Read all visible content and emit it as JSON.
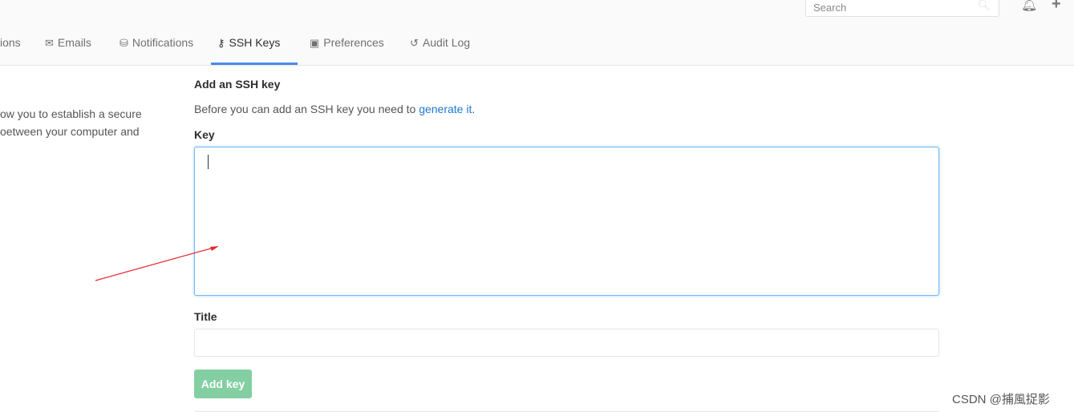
{
  "header": {
    "search_placeholder": "Search",
    "icons": [
      "search-icon",
      "bell-icon",
      "plus-icon"
    ]
  },
  "tabs": [
    {
      "label": "ions",
      "icon": ""
    },
    {
      "label": "Emails",
      "icon": "✉"
    },
    {
      "label": "Notifications",
      "icon": "⛁"
    },
    {
      "label": "SSH Keys",
      "icon": "🔑",
      "active": true
    },
    {
      "label": "Preferences",
      "icon": "▣"
    },
    {
      "label": "Audit Log",
      "icon": "↺"
    }
  ],
  "sidebar": {
    "line1": "ow you to establish a secure",
    "line2": "oetween your computer and"
  },
  "form": {
    "heading": "Add an SSH key",
    "desc": "Before you can add an SSH key you need to ",
    "desc_link": "generate it",
    "desc_end": ".",
    "key_label": "Key",
    "key_value": "",
    "title_label": "Title",
    "title_value": "",
    "submit": "Add key"
  },
  "watermark": "CSDN @捕風捉影",
  "colors": {
    "accent": "#4a8bee",
    "link": "#1f78d1",
    "button": "#83cfa2",
    "annotation_arrow": "#e8262a"
  }
}
